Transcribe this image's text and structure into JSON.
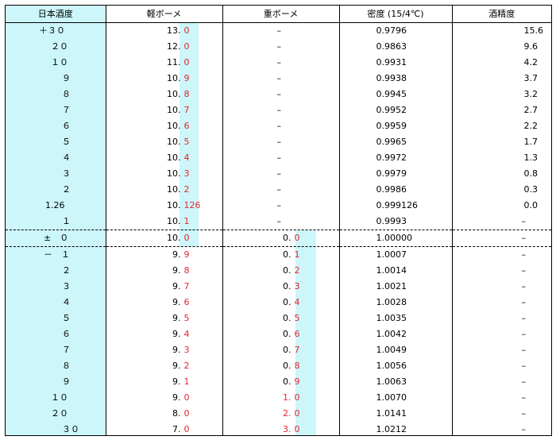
{
  "headers": [
    "日本酒度",
    "軽ボーメ",
    "重ボーメ",
    "密度 (15/4℃)",
    "酒精度"
  ],
  "rows": [
    {
      "sake": "＋３０",
      "light_int": "13.",
      "light_dec": "0",
      "heavy_int": "",
      "heavy_dec": "",
      "heavy_dash": "–",
      "density": "0.9796",
      "alcohol": "15.6"
    },
    {
      "sake": "２０",
      "light_int": "12.",
      "light_dec": "0",
      "heavy_int": "",
      "heavy_dec": "",
      "heavy_dash": "–",
      "density": "0.9863",
      "alcohol": "9.6"
    },
    {
      "sake": "１０",
      "light_int": "11.",
      "light_dec": "0",
      "heavy_int": "",
      "heavy_dec": "",
      "heavy_dash": "–",
      "density": "0.9931",
      "alcohol": "4.2"
    },
    {
      "sake": "９",
      "light_int": "10.",
      "light_dec": "9",
      "heavy_int": "",
      "heavy_dec": "",
      "heavy_dash": "–",
      "density": "0.9938",
      "alcohol": "3.7"
    },
    {
      "sake": "８",
      "light_int": "10.",
      "light_dec": "8",
      "heavy_int": "",
      "heavy_dec": "",
      "heavy_dash": "–",
      "density": "0.9945",
      "alcohol": "3.2"
    },
    {
      "sake": "７",
      "light_int": "10.",
      "light_dec": "7",
      "heavy_int": "",
      "heavy_dec": "",
      "heavy_dash": "–",
      "density": "0.9952",
      "alcohol": "2.7"
    },
    {
      "sake": "６",
      "light_int": "10.",
      "light_dec": "6",
      "heavy_int": "",
      "heavy_dec": "",
      "heavy_dash": "–",
      "density": "0.9959",
      "alcohol": "2.2"
    },
    {
      "sake": "５",
      "light_int": "10.",
      "light_dec": "5",
      "heavy_int": "",
      "heavy_dec": "",
      "heavy_dash": "–",
      "density": "0.9965",
      "alcohol": "1.7"
    },
    {
      "sake": "４",
      "light_int": "10.",
      "light_dec": "4",
      "heavy_int": "",
      "heavy_dec": "",
      "heavy_dash": "–",
      "density": "0.9972",
      "alcohol": "1.3"
    },
    {
      "sake": "３",
      "light_int": "10.",
      "light_dec": "3",
      "heavy_int": "",
      "heavy_dec": "",
      "heavy_dash": "–",
      "density": "0.9979",
      "alcohol": "0.8"
    },
    {
      "sake": "２",
      "light_int": "10.",
      "light_dec": "2",
      "heavy_int": "",
      "heavy_dec": "",
      "heavy_dash": "–",
      "density": "0.9986",
      "alcohol": "0.3"
    },
    {
      "sake": "1.26",
      "light_int": "10.",
      "light_dec": "126",
      "heavy_int": "",
      "heavy_dec": "",
      "heavy_dash": "–",
      "density": "0.999126",
      "alcohol": "0.0"
    },
    {
      "sake": "１",
      "light_int": "10.",
      "light_dec": "1",
      "heavy_int": "",
      "heavy_dec": "",
      "heavy_dash": "–",
      "density": "0.9993",
      "alcohol": "–"
    },
    {
      "sake": "±　０",
      "light_int": "10.",
      "light_dec": "0",
      "heavy_int": "0.",
      "heavy_dec": "0",
      "heavy_dash": "",
      "density": "1.00000",
      "alcohol": "–"
    },
    {
      "sake": "－　１",
      "light_int": "9.",
      "light_dec": "9",
      "heavy_int": "0.",
      "heavy_dec": "1",
      "heavy_dash": "",
      "density": "1.0007",
      "alcohol": "–"
    },
    {
      "sake": "２",
      "light_int": "9.",
      "light_dec": "8",
      "heavy_int": "0.",
      "heavy_dec": "2",
      "heavy_dash": "",
      "density": "1.0014",
      "alcohol": "–"
    },
    {
      "sake": "３",
      "light_int": "9.",
      "light_dec": "7",
      "heavy_int": "0.",
      "heavy_dec": "3",
      "heavy_dash": "",
      "density": "1.0021",
      "alcohol": "–"
    },
    {
      "sake": "４",
      "light_int": "9.",
      "light_dec": "6",
      "heavy_int": "0.",
      "heavy_dec": "4",
      "heavy_dash": "",
      "density": "1.0028",
      "alcohol": "–"
    },
    {
      "sake": "５",
      "light_int": "9.",
      "light_dec": "5",
      "heavy_int": "0.",
      "heavy_dec": "5",
      "heavy_dash": "",
      "density": "1.0035",
      "alcohol": "–"
    },
    {
      "sake": "６",
      "light_int": "9.",
      "light_dec": "4",
      "heavy_int": "0.",
      "heavy_dec": "6",
      "heavy_dash": "",
      "density": "1.0042",
      "alcohol": "–"
    },
    {
      "sake": "７",
      "light_int": "9.",
      "light_dec": "3",
      "heavy_int": "0.",
      "heavy_dec": "7",
      "heavy_dash": "",
      "density": "1.0049",
      "alcohol": "–"
    },
    {
      "sake": "８",
      "light_int": "9.",
      "light_dec": "2",
      "heavy_int": "0.",
      "heavy_dec": "8",
      "heavy_dash": "",
      "density": "1.0056",
      "alcohol": "–"
    },
    {
      "sake": "９",
      "light_int": "9.",
      "light_dec": "1",
      "heavy_int": "0.",
      "heavy_dec": "9",
      "heavy_dash": "",
      "density": "1.0063",
      "alcohol": "–"
    },
    {
      "sake": "１０",
      "light_int": "9.",
      "light_dec": "0",
      "heavy_int": "1.",
      "heavy_dec": "0",
      "heavy_dash": "",
      "density": "1.0070",
      "alcohol": "–",
      "heavy_red_int": true
    },
    {
      "sake": "２０",
      "light_int": "8.",
      "light_dec": "0",
      "heavy_int": "2.",
      "heavy_dec": "0",
      "heavy_dash": "",
      "density": "1.0141",
      "alcohol": "–",
      "heavy_red_int": true
    },
    {
      "sake": "３０",
      "light_int": "7.",
      "light_dec": "0",
      "heavy_int": "3.",
      "heavy_dec": "0",
      "heavy_dash": "",
      "density": "1.0212",
      "alcohol": "–",
      "heavy_red_int": true
    }
  ]
}
